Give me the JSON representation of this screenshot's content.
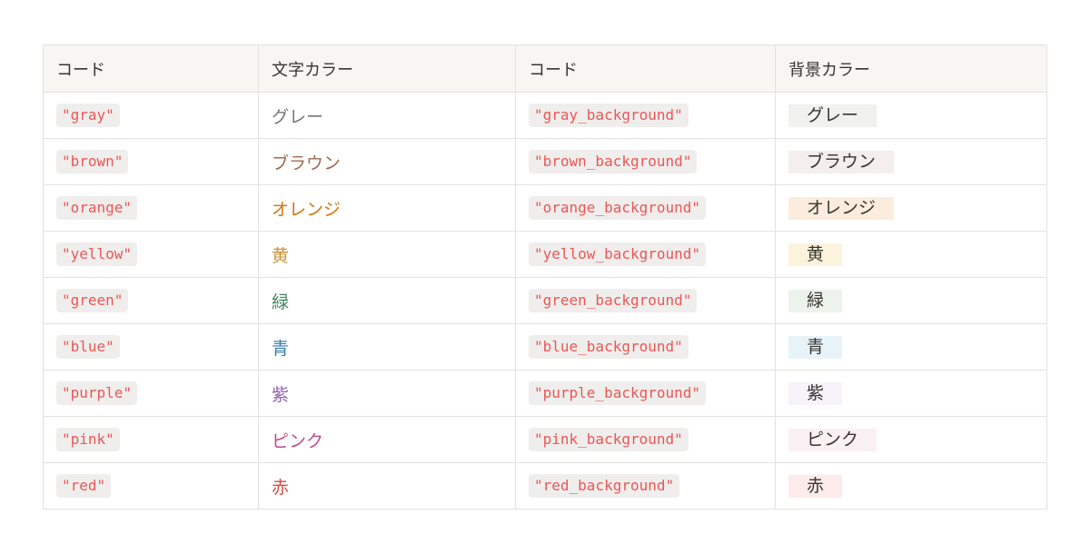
{
  "headers": [
    "コード",
    "文字カラー",
    "コード",
    "背景カラー"
  ],
  "rows": [
    {
      "code": "\"gray\"",
      "text_label": "グレー",
      "text_color": "#787774",
      "bg_code": "\"gray_background\"",
      "bg_label": "グレー",
      "bg_color": "#f1f1ef"
    },
    {
      "code": "\"brown\"",
      "text_label": "ブラウン",
      "text_color": "#9f6b53",
      "bg_code": "\"brown_background\"",
      "bg_label": "ブラウン",
      "bg_color": "#f4eeee"
    },
    {
      "code": "\"orange\"",
      "text_label": "オレンジ",
      "text_color": "#d9730d",
      "bg_code": "\"orange_background\"",
      "bg_label": "オレンジ",
      "bg_color": "#fbecdd"
    },
    {
      "code": "\"yellow\"",
      "text_label": "黄",
      "text_color": "#cb912f",
      "bg_code": "\"yellow_background\"",
      "bg_label": "黄",
      "bg_color": "#fbf3db"
    },
    {
      "code": "\"green\"",
      "text_label": "緑",
      "text_color": "#448361",
      "bg_code": "\"green_background\"",
      "bg_label": "緑",
      "bg_color": "#edf3ec"
    },
    {
      "code": "\"blue\"",
      "text_label": "青",
      "text_color": "#337ea9",
      "bg_code": "\"blue_background\"",
      "bg_label": "青",
      "bg_color": "#e7f3f8"
    },
    {
      "code": "\"purple\"",
      "text_label": "紫",
      "text_color": "#9065b0",
      "bg_code": "\"purple_background\"",
      "bg_label": "紫",
      "bg_color": "#f6f3f9"
    },
    {
      "code": "\"pink\"",
      "text_label": "ピンク",
      "text_color": "#c14c8a",
      "bg_code": "\"pink_background\"",
      "bg_label": "ピンク",
      "bg_color": "#faf1f5"
    },
    {
      "code": "\"red\"",
      "text_label": "赤",
      "text_color": "#d44c47",
      "bg_code": "\"red_background\"",
      "bg_label": "赤",
      "bg_color": "#fdebec"
    }
  ],
  "code_color": "#eb5757",
  "code_bg_color": "#efeeec"
}
